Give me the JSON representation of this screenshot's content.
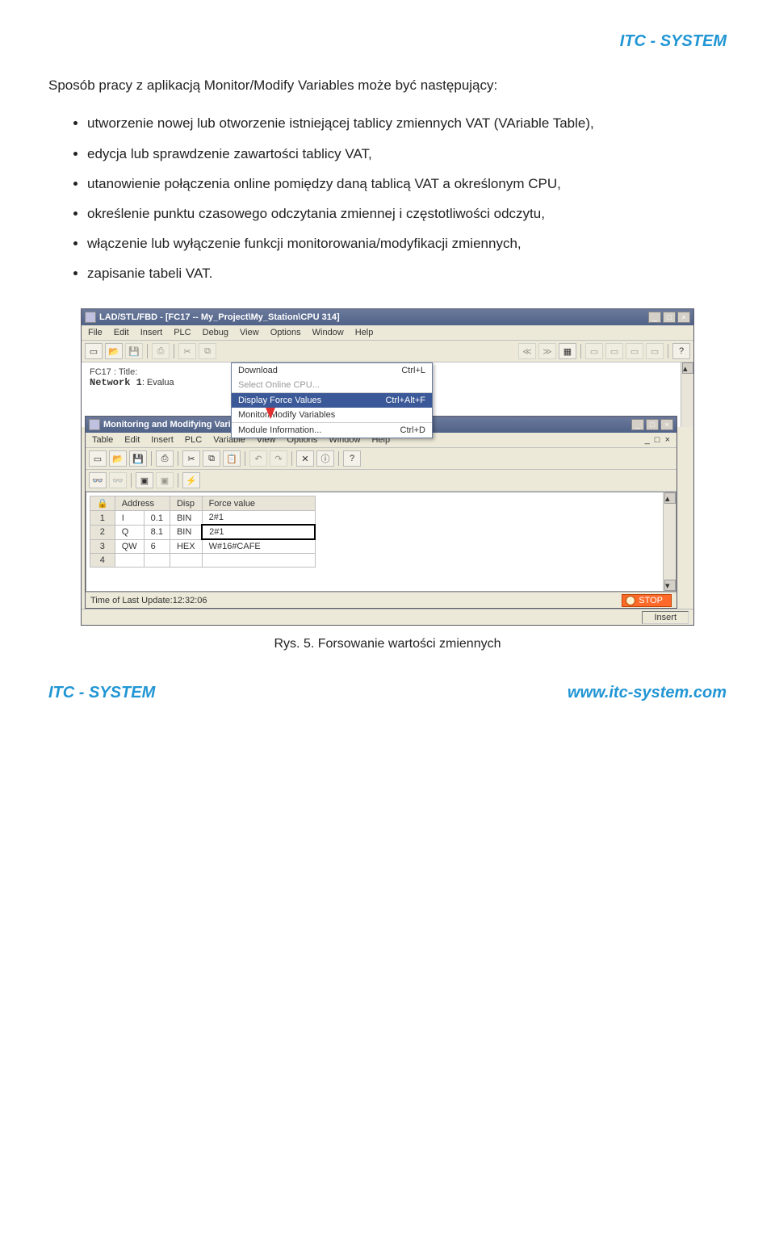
{
  "brand": "ITC - SYSTEM",
  "intro": "Sposób pracy z aplikacją Monitor/Modify Variables może być następujący:",
  "bullets": [
    "utworzenie nowej lub otworzenie istniejącej tablicy zmiennych VAT (VAriable Table),",
    "edycja lub sprawdzenie zawartości tablicy VAT,",
    "utanowienie połączenia online pomiędzy daną tablicą VAT a określonym CPU,",
    "określenie punktu czasowego odczytania zmiennej i częstotliwości odczytu,",
    "włączenie lub wyłączenie funkcji monitorowania/modyfikacji zmiennych,",
    "zapisanie tabeli VAT."
  ],
  "main_window": {
    "title": "LAD/STL/FBD - [FC17 -- My_Project\\My_Station\\CPU 314]",
    "menu": [
      "File",
      "Edit",
      "Insert",
      "PLC",
      "Debug",
      "View",
      "Options",
      "Window",
      "Help"
    ],
    "code_title": "FC17 : Title:",
    "network": "Network 1",
    "network_suffix": ": Evalua",
    "dropdown": [
      {
        "label": "Download",
        "accel": "Ctrl+L",
        "sel": false,
        "dis": false
      },
      {
        "label": "Select Online CPU...",
        "accel": "",
        "sel": false,
        "dis": true
      },
      {
        "label": "Display Force Values",
        "accel": "Ctrl+Alt+F",
        "sel": true,
        "dis": false
      },
      {
        "label": "Monitor/Modify Variables",
        "accel": "",
        "sel": false,
        "dis": false
      },
      {
        "label": "Module Information...",
        "accel": "Ctrl+D",
        "sel": false,
        "dis": false
      }
    ]
  },
  "sub_window": {
    "title": "Monitoring and Modifying Variables - [Force Values : My_Project\\My_Stati...",
    "menu": [
      "Table",
      "Edit",
      "Insert",
      "PLC",
      "Variable",
      "View",
      "Options",
      "Window",
      "Help"
    ],
    "headers": [
      "",
      "Address",
      "Disp",
      "Force value"
    ],
    "rows": [
      {
        "n": "1",
        "addr_type": "I",
        "addr": "0.1",
        "disp": "BIN",
        "val": "2#1",
        "sel": false
      },
      {
        "n": "2",
        "addr_type": "Q",
        "addr": "8.1",
        "disp": "BIN",
        "val": "2#1",
        "sel": true
      },
      {
        "n": "3",
        "addr_type": "QW",
        "addr": "6",
        "disp": "HEX",
        "val": "W#16#CAFE",
        "sel": false
      },
      {
        "n": "4",
        "addr_type": "",
        "addr": "",
        "disp": "",
        "val": "",
        "sel": false
      }
    ],
    "status_time": "Time of Last Update:12:32:06",
    "stop": "STOP",
    "insert": "Insert"
  },
  "caption": "Rys. 5. Forsowanie wartości zmiennych",
  "footer_left": "ITC - SYSTEM",
  "footer_right": "www.itc-system.com"
}
